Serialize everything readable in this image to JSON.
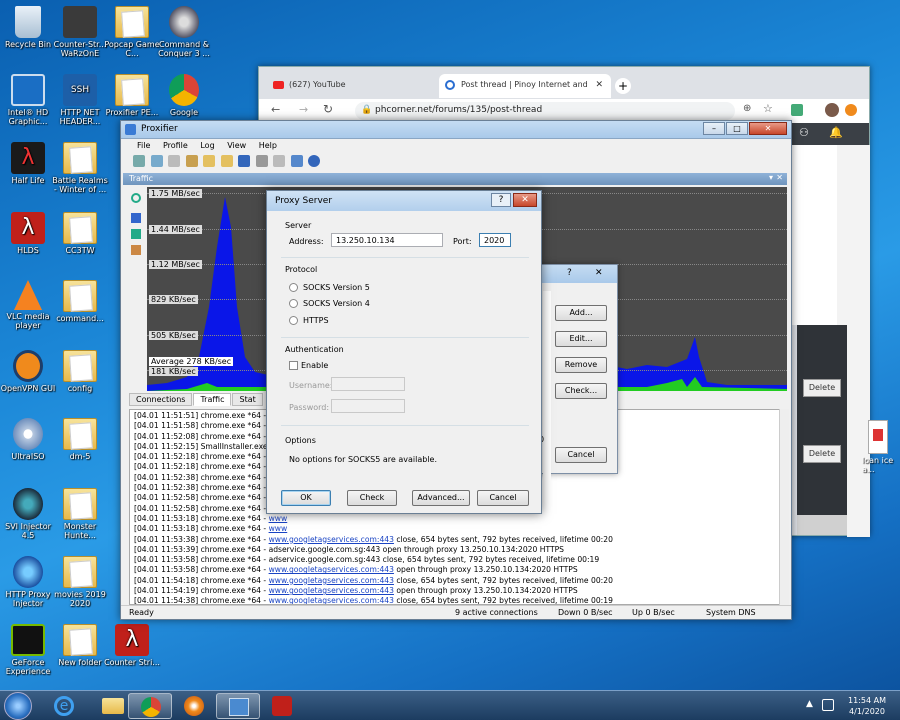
{
  "desktop": {
    "icons": [
      {
        "label": "Recycle Bin"
      },
      {
        "label": "Counter-Str... WaRzOnE"
      },
      {
        "label": "Popcap Game C..."
      },
      {
        "label": "Command & Conquer 3 ..."
      },
      {
        "label": "Intel® HD Graphic..."
      },
      {
        "label": "HTTP NET HEADER..."
      },
      {
        "label": "Proxifier PE..."
      },
      {
        "label": "Google"
      },
      {
        "label": "Half Life"
      },
      {
        "label": "Battle Realms - Winter of ..."
      },
      {
        "label": "HLDS"
      },
      {
        "label": "CC3TW"
      },
      {
        "label": "VLC media player"
      },
      {
        "label": "command..."
      },
      {
        "label": "OpenVPN GUI"
      },
      {
        "label": "config"
      },
      {
        "label": "UltraISO"
      },
      {
        "label": "dm-5"
      },
      {
        "label": "SVI Injector 4.5"
      },
      {
        "label": "Monster Hunte..."
      },
      {
        "label": "HTTP Proxy Injector"
      },
      {
        "label": "movies 2019 2020"
      },
      {
        "label": "GeForce Experience"
      },
      {
        "label": "New folder"
      },
      {
        "label": "Counter Stri..."
      }
    ]
  },
  "chrome": {
    "tab1": "(627) YouTube",
    "tab2": "Post thread | Pinoy Internet and",
    "url": "phcorner.net/forums/135/post-thread",
    "delete1": "Delete",
    "delete2": "Delete",
    "side_text": "loan ice a..."
  },
  "proxifier": {
    "title": "Proxifier",
    "menu": [
      "File",
      "Profile",
      "Log",
      "View",
      "Help"
    ],
    "traffic_header": "Traffic",
    "y_labels": [
      "1.75 MB/sec",
      "1.44 MB/sec",
      "1.12 MB/sec",
      "829 KB/sec",
      "505 KB/sec",
      "181 KB/sec"
    ],
    "average_label": "Average 278 KB/sec",
    "tabs": [
      "Connections",
      "Traffic",
      "Stat"
    ],
    "log_lines": [
      {
        "pre": "[04.01 11:51:51] chrome.exe *64 - client",
        "link": "",
        "post": ""
      },
      {
        "pre": "[04.01 11:51:58] chrome.exe *64 - adser",
        "link": "",
        "post": ""
      },
      {
        "pre": "[04.01 11:52:08] chrome.exe *64 - client",
        "link": "",
        "post": ""
      },
      {
        "pre": "[04.01 11:52:15] SmallInstaller.exe - dow",
        "link": "",
        "post": ""
      },
      {
        "pre": "[04.01 11:52:18] chrome.exe *64 - adser",
        "link": "",
        "post": ""
      },
      {
        "pre": "[04.01 11:52:18] chrome.exe *64 - adser",
        "link": "",
        "post": ""
      },
      {
        "pre": "[04.01 11:52:38] chrome.exe *64 - adser",
        "link": "",
        "post": ""
      },
      {
        "pre": "[04.01 11:52:38] chrome.exe *64 - adser",
        "link": "",
        "post": ""
      },
      {
        "pre": "[04.01 11:52:58] chrome.exe *64 - adser",
        "link": "",
        "post": ""
      },
      {
        "pre": "[04.01 11:52:58] chrome.exe *64 - ",
        "link": "www",
        "post": ""
      },
      {
        "pre": "[04.01 11:53:18] chrome.exe *64 - ",
        "link": "www",
        "post": ""
      },
      {
        "pre": "[04.01 11:53:18] chrome.exe *64 - ",
        "link": "www",
        "post": ""
      },
      {
        "pre": "[04.01 11:53:38] chrome.exe *64 - ",
        "link": "www.googletagservices.com:443",
        "post": " close, 654 bytes sent, 792 bytes received, lifetime 00:20"
      },
      {
        "pre": "[04.01 11:53:39] chrome.exe *64 - adservice.google.com.sg:443 open through proxy 13.250.10.134:2020 HTTPS",
        "link": "",
        "post": ""
      },
      {
        "pre": "[04.01 11:53:58] chrome.exe *64 - adservice.google.com.sg:443 close, 654 bytes sent, 792 bytes received, lifetime 00:19",
        "link": "",
        "post": ""
      },
      {
        "pre": "[04.01 11:53:58] chrome.exe *64 - ",
        "link": "www.googletagservices.com:443",
        "post": " open through proxy 13.250.10.134:2020 HTTPS"
      },
      {
        "pre": "[04.01 11:54:18] chrome.exe *64 - ",
        "link": "www.googletagservices.com:443",
        "post": " close, 654 bytes sent, 792 bytes received, lifetime 00:20"
      },
      {
        "pre": "[04.01 11:54:19] chrome.exe *64 - ",
        "link": "www.googletagservices.com:443",
        "post": " open through proxy 13.250.10.134:2020 HTTPS"
      },
      {
        "pre": "[04.01 11:54:38] chrome.exe *64 - ",
        "link": "www.googletagservices.com:443",
        "post": " close, 654 bytes sent, 792 bytes received, lifetime 00:19"
      },
      {
        "pre": "[04.01 11:54:39] chrome.exe *64 - adservice.google.com:443 open through proxy 13.250.10.134:2020 HTTPS",
        "link": "",
        "post": ""
      }
    ],
    "status": {
      "ready": "Ready",
      "connections": "9 active connections",
      "down": "Down 0 B/sec",
      "up": "Up 0 B/sec",
      "dns": "System DNS"
    }
  },
  "proxy_list_dialog": {
    "buttons": [
      "Add...",
      "Edit...",
      "Remove",
      "Check..."
    ],
    "cancel": "Cancel",
    "partial_text": "0"
  },
  "proxy_dialog": {
    "title": "Proxy Server",
    "server_group": "Server",
    "address_label": "Address:",
    "address_value": "13.250.10.134",
    "port_label": "Port:",
    "port_value": "2020",
    "protocol_group": "Protocol",
    "protocols": [
      "SOCKS Version 5",
      "SOCKS Version 4",
      "HTTPS"
    ],
    "auth_group": "Authentication",
    "enable_label": "Enable",
    "username_label": "Username:",
    "password_label": "Password:",
    "options_group": "Options",
    "options_text": "No options for SOCKS5 are available.",
    "ok": "OK",
    "check": "Check",
    "advanced": "Advanced...",
    "cancel": "Cancel"
  },
  "taskbar": {
    "time": "11:54 AM",
    "date": "4/1/2020"
  }
}
